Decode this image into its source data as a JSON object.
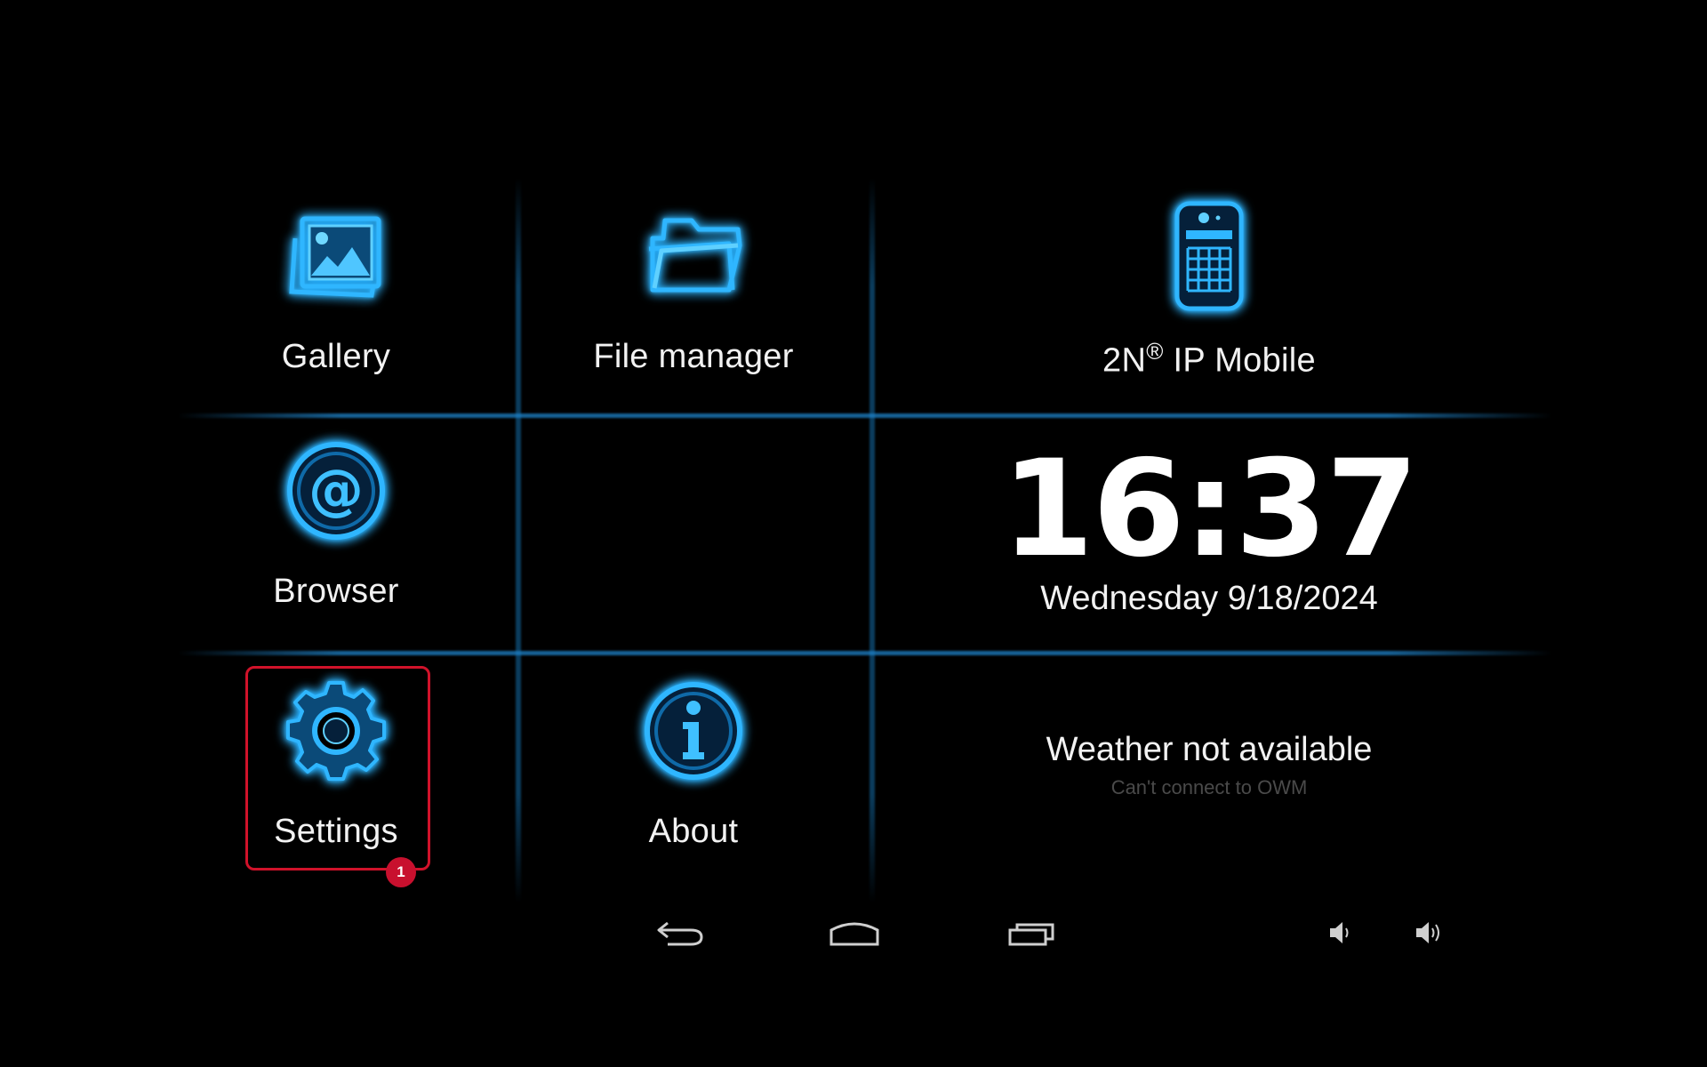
{
  "colors": {
    "background": "#000000",
    "icon_glow": "#1aa8ff",
    "grid_line": "#1e82c8",
    "highlight": "#d0122a",
    "subtext": "#4a4a4a"
  },
  "tiles": {
    "gallery": {
      "label": "Gallery",
      "icon": "gallery-icon"
    },
    "file_manager": {
      "label": "File manager",
      "icon": "folder-icon"
    },
    "ip_mobile": {
      "label_prefix": "2N",
      "label_mark": "®",
      "label_suffix": " IP Mobile",
      "icon": "intercom-icon"
    },
    "browser": {
      "label": "Browser",
      "icon": "at-sign-icon"
    },
    "settings": {
      "label": "Settings",
      "icon": "gear-icon"
    },
    "about": {
      "label": "About",
      "icon": "info-icon"
    }
  },
  "clock": {
    "time": "16:37",
    "date": "Wednesday 9/18/2024"
  },
  "weather": {
    "title": "Weather not available",
    "subtitle": "Can't connect to OWM"
  },
  "annotation": {
    "badge": "1"
  },
  "navbar": {
    "back": "back-icon",
    "home": "home-icon",
    "recents": "recent-apps-icon",
    "volume_down": "volume-down-icon",
    "volume_up": "volume-up-icon"
  }
}
